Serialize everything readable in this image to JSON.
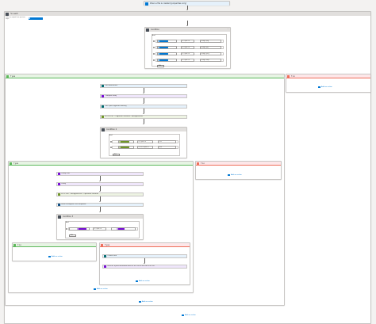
{
  "colors": {
    "trigger": "#0078d4",
    "control": "#484f58",
    "sharepoint": "#036c70",
    "variable": "#770bd6",
    "http": "#709727",
    "json": "#0f4c81",
    "true_branch": "#5db85c",
    "false_branch": "#ee6e5a",
    "link": "#0078d4"
  },
  "trigger": {
    "title": "When a file is created (properties only)",
    "icon": "sharepoint-icon"
  },
  "for_each": {
    "title": "For each",
    "select_label": "Select an output from previous steps",
    "token": "value"
  },
  "condition_outer": {
    "title": "Condition",
    "group": "And",
    "rows": [
      {
        "token": "FileName",
        "op": "is equal to",
        "value": "image.png"
      },
      {
        "token": "FileName",
        "op": "is equal to",
        "value": "image.jpg"
      },
      {
        "token": "FileName",
        "op": "is equal to",
        "value": "image.jpeg"
      },
      {
        "token": "FileName",
        "op": "is equal to",
        "value": "image.bmp"
      }
    ],
    "add_label": "Add"
  },
  "if_yes": {
    "title": "If yes",
    "steps": [
      "Get attachment",
      "Compose body",
      "Get OpenCognition Identity",
      "HTTP POST - Cognitive Services - RecognizeText",
      "Condition 2"
    ],
    "condition2": {
      "group": "And",
      "rows": [
        {
          "token": "Status code",
          "op": "is equal to",
          "value": "202"
        },
        {
          "token": "Status code",
          "op": "is not equal to",
          "value": "400"
        }
      ],
      "add_label": "Add"
    }
  },
  "if_no": {
    "title": "If no",
    "add_action": "Add an action"
  },
  "inner_yes": {
    "title": "If yes",
    "steps": [
      "Delay Until",
      "Delay",
      "HTTP GET - RecognizeText - Operation Location",
      "Parse Recognize Text Response",
      "Condition 3"
    ],
    "condition3": {
      "group": "And",
      "rows": [
        {
          "token": "status",
          "op": "is equal to",
          "value": "status"
        }
      ],
      "add_label": "Add"
    }
  },
  "inner_no": {
    "title": "If no",
    "add_action": "Add an action"
  },
  "deep_no": {
    "title": "If no",
    "add_action": "Add an action"
  },
  "deep_yes": {
    "title": "If yes",
    "steps": [
      "Create item",
      "Send me a push notification with the file text to an item in the list"
    ],
    "add_action": "Add an action"
  },
  "add_action_inner_yes": "Add an action",
  "add_action_yes": "Add an action",
  "add_action_foreach": "Add an action"
}
